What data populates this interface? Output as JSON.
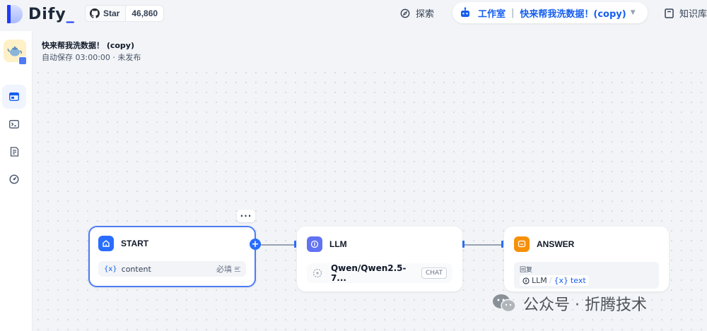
{
  "brand": {
    "name": "Dify",
    "cursor": "_"
  },
  "github": {
    "label": "Star",
    "count": "46,860"
  },
  "nav": {
    "explore": "探索",
    "studio": "工作室",
    "app_name": "快来帮我洗数据！(copy)",
    "knowledge": "知识库"
  },
  "app": {
    "title": "快来帮我洗数据！ (copy)",
    "status": "自动保存 03:00:00 · 未发布"
  },
  "nodes": {
    "start": {
      "title": "START",
      "var_brace": "{x}",
      "var_name": "content",
      "required": "必填"
    },
    "llm": {
      "title": "LLM",
      "model": "Qwen/Qwen2.5-7...",
      "mode": "CHAT"
    },
    "answer": {
      "title": "ANSWER",
      "label": "回复",
      "source": "LLM",
      "var_brace": "{x}",
      "var_name": "text"
    }
  },
  "more_label": "···",
  "plus_label": "+",
  "watermark": "公众号 · 折腾技术",
  "colors": {
    "accent": "#155eef",
    "start_icon": "#296dff",
    "llm_icon": "#6172f3",
    "answer_icon": "#f79009"
  }
}
